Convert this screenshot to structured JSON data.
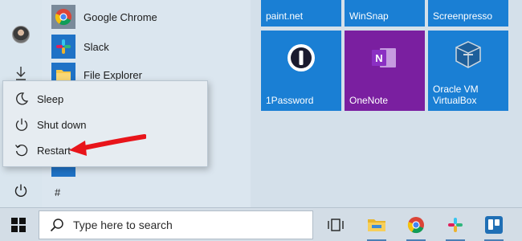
{
  "apps": [
    {
      "label": "Google Chrome",
      "icon": "chrome-icon"
    },
    {
      "label": "Slack",
      "icon": "slack-icon"
    },
    {
      "label": "File Explorer",
      "icon": "folder-icon"
    }
  ],
  "applist": {
    "section_letter": "#"
  },
  "tiles": [
    {
      "label": "paint.net",
      "color": "#1a7fd4"
    },
    {
      "label": "WinSnap",
      "color": "#1a7fd4"
    },
    {
      "label": "Screenpresso",
      "color": "#1a7fd4"
    },
    {
      "label": "1Password",
      "color": "#1a7fd4",
      "icon": "onepassword-icon"
    },
    {
      "label": "OneNote",
      "color": "#7a1fa0",
      "icon": "onenote-icon"
    },
    {
      "label": "Oracle VM\nVirtualBox",
      "color": "#1a7fd4",
      "icon": "virtualbox-icon"
    }
  ],
  "power_menu": {
    "items": [
      {
        "label": "Sleep",
        "icon": "moon-icon"
      },
      {
        "label": "Shut down",
        "icon": "power-icon"
      },
      {
        "label": "Restart",
        "icon": "restart-icon"
      }
    ],
    "highlight": "Restart",
    "arrow_color": "#e8141a"
  },
  "taskbar": {
    "search_placeholder": "Type here to search",
    "pinned": [
      "task-view-icon",
      "file-explorer-icon",
      "chrome-icon",
      "slack-icon",
      "trello-icon"
    ]
  },
  "colors": {
    "accent": "#1a7fd4",
    "onenote": "#7a1fa0",
    "trello": "#1f6fb5"
  }
}
